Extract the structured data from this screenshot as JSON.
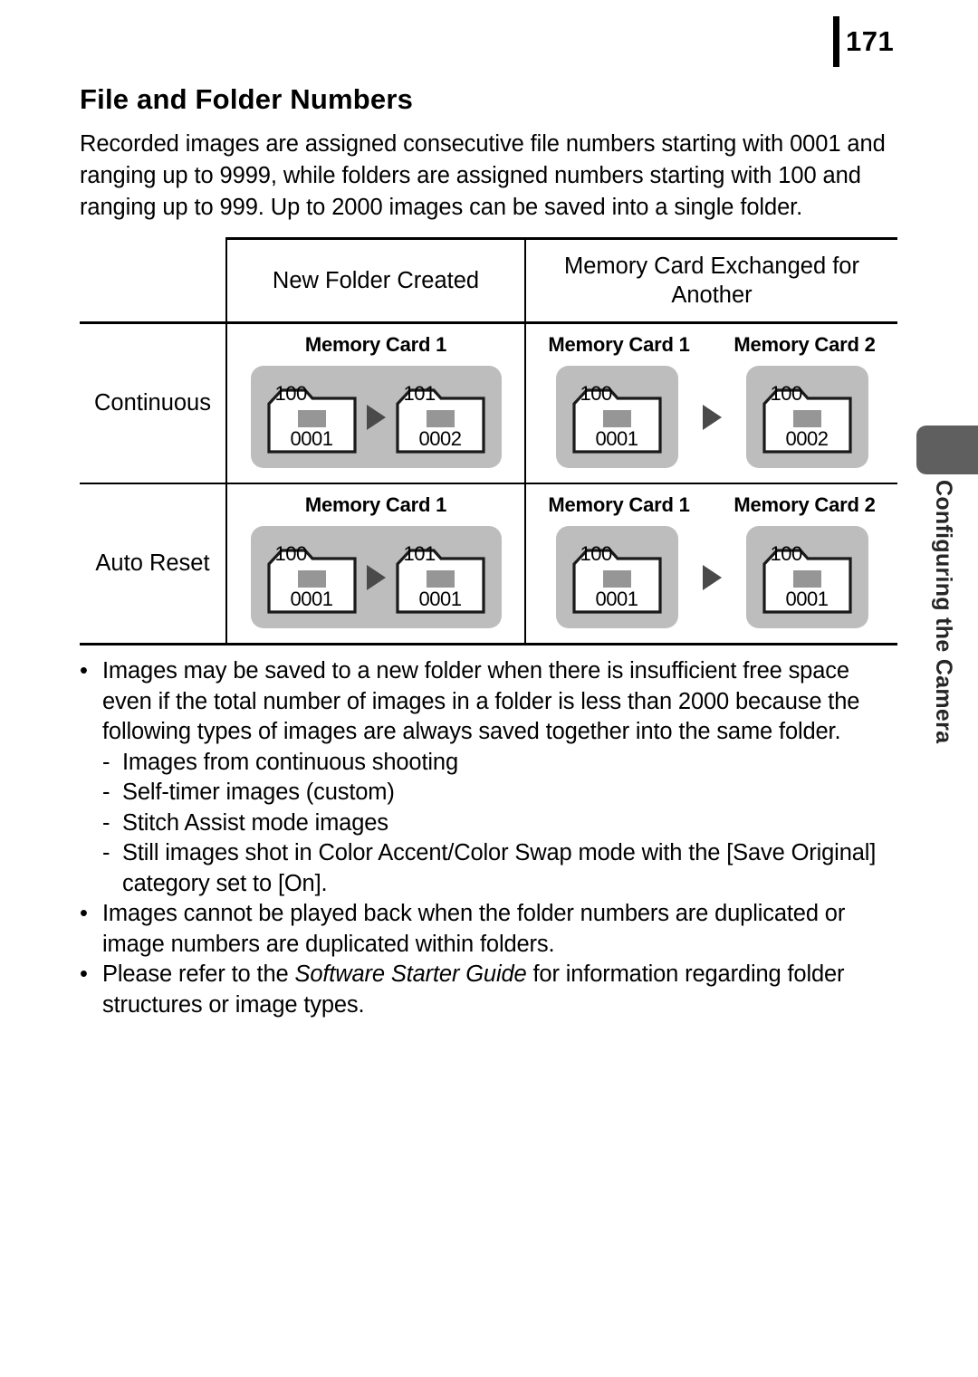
{
  "page": {
    "number": "171",
    "title": "File and Folder Numbers",
    "intro": "Recorded images are assigned consecutive file numbers starting with 0001 and ranging up to 9999, while folders are assigned numbers starting with 100 and ranging up to 999. Up to 2000 images can be saved into a single folder."
  },
  "table": {
    "headers": {
      "blank": "",
      "new_folder": "New Folder Created",
      "exchanged": "Memory Card Exchanged for Another"
    },
    "subheaders": {
      "new_folder_card": "Memory Card 1",
      "exchanged_card_1": "Memory Card 1",
      "exchanged_card_2": "Memory Card 2"
    },
    "rows": [
      {
        "label": "Continuous",
        "new_folder": {
          "folders": [
            {
              "folder_number": "100",
              "image_number": "0001"
            },
            {
              "folder_number": "101",
              "image_number": "0002"
            }
          ]
        },
        "exchanged": {
          "card1": {
            "folder_number": "100",
            "image_number": "0001"
          },
          "card2": {
            "folder_number": "100",
            "image_number": "0002"
          }
        }
      },
      {
        "label": "Auto Reset",
        "new_folder": {
          "folders": [
            {
              "folder_number": "100",
              "image_number": "0001"
            },
            {
              "folder_number": "101",
              "image_number": "0001"
            }
          ]
        },
        "exchanged": {
          "card1": {
            "folder_number": "100",
            "image_number": "0001"
          },
          "card2": {
            "folder_number": "100",
            "image_number": "0001"
          }
        }
      }
    ]
  },
  "notes": {
    "bullet_mark": "•",
    "dash_mark": "-",
    "items": [
      {
        "text": "Images may be saved to a new folder when there is insufficient free space even if the total number of images in a folder is less than 2000 because the following types of images are always saved together into the same folder.",
        "subitems": [
          "Images from continuous shooting",
          "Self-timer images (custom)",
          "Stitch Assist mode images"
        ],
        "subitem_rich": {
          "prefix": "Still images shot in Color Accent/Color Swap mode with the [Save Original] category set to [On]."
        }
      },
      {
        "text": "Images cannot be played back when the folder numbers are duplicated or image numbers are duplicated within folders."
      },
      {
        "text_before": "Please refer to the ",
        "italic": "Software Starter Guide",
        "text_after": " for information regarding folder structures or image types."
      }
    ]
  },
  "side_tab": {
    "label": "Configuring the Camera"
  },
  "colors": {
    "panel_gray": "#bdbdbd",
    "thumb_gray": "#969696",
    "arrow_gray": "#4a4a4a",
    "tab_gray": "#5f5f5f",
    "rule_black": "#000000"
  }
}
